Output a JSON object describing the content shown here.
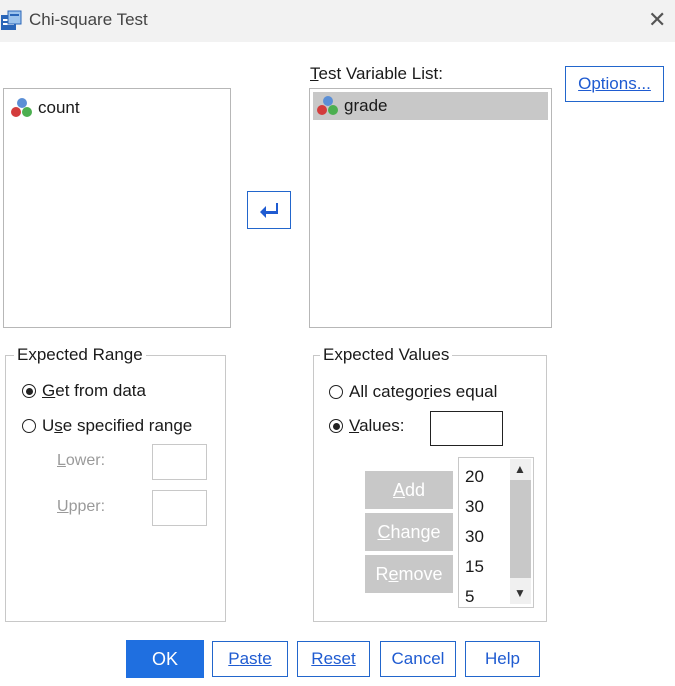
{
  "window": {
    "title": "Chi-square Test",
    "close_icon": "close-icon"
  },
  "source_list": {
    "items": [
      {
        "label": "count",
        "icon": "nominal-variable-icon"
      }
    ]
  },
  "test_variable_list": {
    "label_prefix": "T",
    "label_rest": "est Variable List:",
    "items": [
      {
        "label": "grade",
        "icon": "nominal-variable-icon",
        "selected": true
      }
    ]
  },
  "options_button": {
    "u": "O",
    "rest": "ptions..."
  },
  "expected_range": {
    "title": "Expected Range",
    "get_from_data": {
      "u": "G",
      "rest": "et from data",
      "selected": true
    },
    "use_specified_range": {
      "pre": "U",
      "u": "s",
      "rest": "e specified range",
      "selected": false
    },
    "lower": {
      "u": "L",
      "rest": "ower:"
    },
    "upper": {
      "u": "U",
      "rest": "pper:"
    }
  },
  "expected_values": {
    "title": "Expected Values",
    "all_categories_equal": {
      "pre": "All catego",
      "u": "r",
      "rest": "ies equal",
      "selected": false
    },
    "values_radio": {
      "u": "V",
      "rest": "alues:",
      "selected": true
    },
    "values_input": "",
    "add": {
      "u": "A",
      "rest": "dd"
    },
    "change": {
      "u": "C",
      "rest": "hange"
    },
    "remove": {
      "pre": "R",
      "u": "e",
      "rest": "move"
    },
    "values_list": [
      "20",
      "30",
      "30",
      "15",
      "5"
    ]
  },
  "buttons": {
    "ok": "OK",
    "paste": {
      "u": "P",
      "rest": "aste"
    },
    "reset": {
      "u": "R",
      "rest": "eset"
    },
    "cancel": "Cancel",
    "help": "Help"
  }
}
